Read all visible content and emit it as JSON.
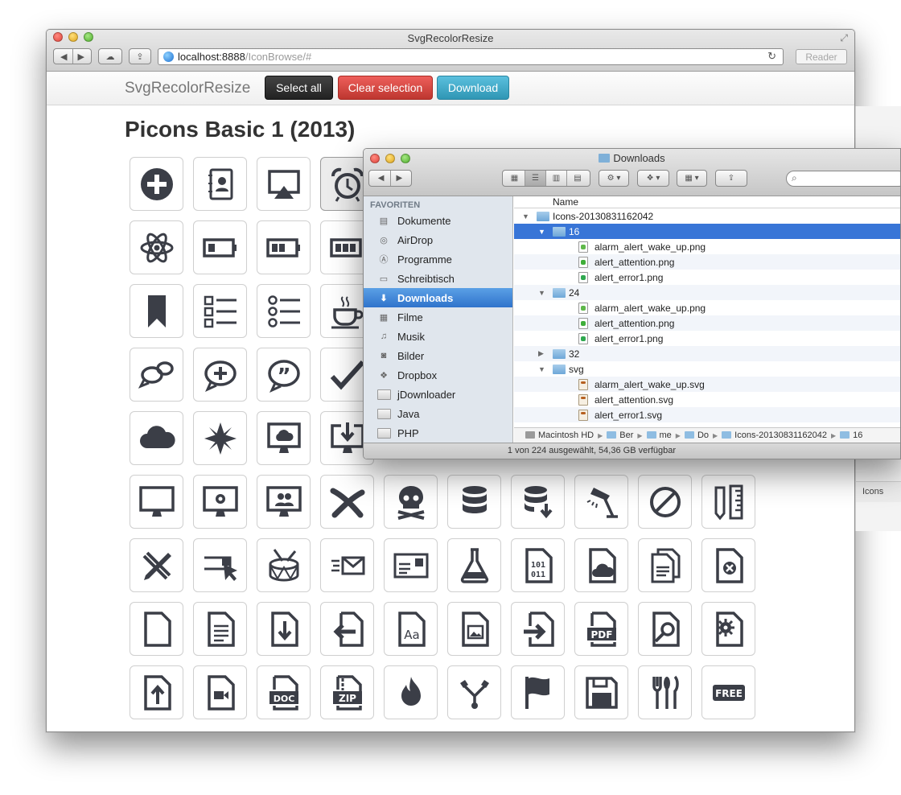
{
  "browser": {
    "title": "SvgRecolorResize",
    "url_host": "localhost:8888",
    "url_path": "/IconBrowse/#",
    "reader_label": "Reader"
  },
  "navbar": {
    "brand": "SvgRecolorResize",
    "select_all": "Select all",
    "clear_selection": "Clear selection",
    "download": "Download"
  },
  "page": {
    "title": "Picons Basic 1 (2013)",
    "icons": [
      "plus-circle",
      "address-book",
      "airplay",
      "alarm-clock",
      "",
      "",
      "",
      "",
      "",
      "",
      "atom",
      "battery-low",
      "battery-half",
      "battery-full",
      "",
      "",
      "",
      "",
      "",
      "",
      "bookmark",
      "checklist",
      "radio-list",
      "coffee-cup",
      "",
      "",
      "",
      "",
      "",
      "",
      "chat-bubbles",
      "chat-add",
      "chat-quote",
      "checkmark",
      "",
      "",
      "",
      "",
      "",
      "",
      "cloud",
      "compass-star",
      "monitor-cloud",
      "monitor-download",
      "",
      "",
      "",
      "",
      "",
      "",
      "monitor",
      "monitor-gear",
      "monitor-users",
      "cross-x",
      "skull",
      "database",
      "database-download",
      "desk-lamp",
      "disabled",
      "pencil-ruler",
      "design-tools",
      "cursor-dialog",
      "drum",
      "email-fast",
      "contact-card",
      "flask",
      "binary-file",
      "file-cloud",
      "file-copies",
      "file-error",
      "file-blank",
      "file-text",
      "file-download",
      "file-export",
      "file-font",
      "file-image",
      "file-import",
      "file-pdf",
      "file-search",
      "file-gear",
      "file-upload",
      "file-video",
      "file-doc",
      "file-zip",
      "fire",
      "firewire",
      "flag",
      "floppy-disk",
      "cutlery",
      "free-badge"
    ]
  },
  "finder": {
    "title": "Downloads",
    "search_placeholder": "",
    "favorites_heading": "FAVORITEN",
    "sidebar": [
      {
        "label": "Dokumente",
        "icon": "documents-icon"
      },
      {
        "label": "AirDrop",
        "icon": "airdrop-icon"
      },
      {
        "label": "Programme",
        "icon": "applications-icon"
      },
      {
        "label": "Schreibtisch",
        "icon": "desktop-icon"
      },
      {
        "label": "Downloads",
        "icon": "downloads-icon",
        "active": true
      },
      {
        "label": "Filme",
        "icon": "movies-icon"
      },
      {
        "label": "Musik",
        "icon": "music-icon"
      },
      {
        "label": "Bilder",
        "icon": "pictures-icon"
      },
      {
        "label": "Dropbox",
        "icon": "dropbox-icon"
      },
      {
        "label": "jDownloader",
        "icon": "folder-icon"
      },
      {
        "label": "Java",
        "icon": "folder-icon"
      },
      {
        "label": "PHP",
        "icon": "folder-icon"
      }
    ],
    "column_header": "Name",
    "rows": [
      {
        "name": "Icons-20130831162042",
        "type": "folder",
        "level": 0,
        "open": true
      },
      {
        "name": "16",
        "type": "folder",
        "level": 1,
        "open": true,
        "selected": true
      },
      {
        "name": "alarm_alert_wake_up.png",
        "type": "png",
        "level": 2,
        "color": "#5fb84a"
      },
      {
        "name": "alert_attention.png",
        "type": "png",
        "level": 2,
        "color": "#3fae3a"
      },
      {
        "name": "alert_error1.png",
        "type": "png",
        "level": 2,
        "color": "#2fa84f"
      },
      {
        "name": "24",
        "type": "folder",
        "level": 1,
        "open": true
      },
      {
        "name": "alarm_alert_wake_up.png",
        "type": "png",
        "level": 2,
        "color": "#5fb84a"
      },
      {
        "name": "alert_attention.png",
        "type": "png",
        "level": 2,
        "color": "#3fae3a"
      },
      {
        "name": "alert_error1.png",
        "type": "png",
        "level": 2,
        "color": "#2fa84f"
      },
      {
        "name": "32",
        "type": "folder",
        "level": 1,
        "open": false
      },
      {
        "name": "svg",
        "type": "folder",
        "level": 1,
        "open": true
      },
      {
        "name": "alarm_alert_wake_up.svg",
        "type": "svg",
        "level": 2
      },
      {
        "name": "alert_attention.svg",
        "type": "svg",
        "level": 2
      },
      {
        "name": "alert_error1.svg",
        "type": "svg",
        "level": 2
      }
    ],
    "path": [
      "Macintosh HD",
      "Ber",
      "me",
      "Do",
      "Icons-20130831162042",
      "16"
    ],
    "status": "1 von 224 ausgewählt, 54,36 GB verfügbar",
    "background_path_label": "Icons"
  }
}
